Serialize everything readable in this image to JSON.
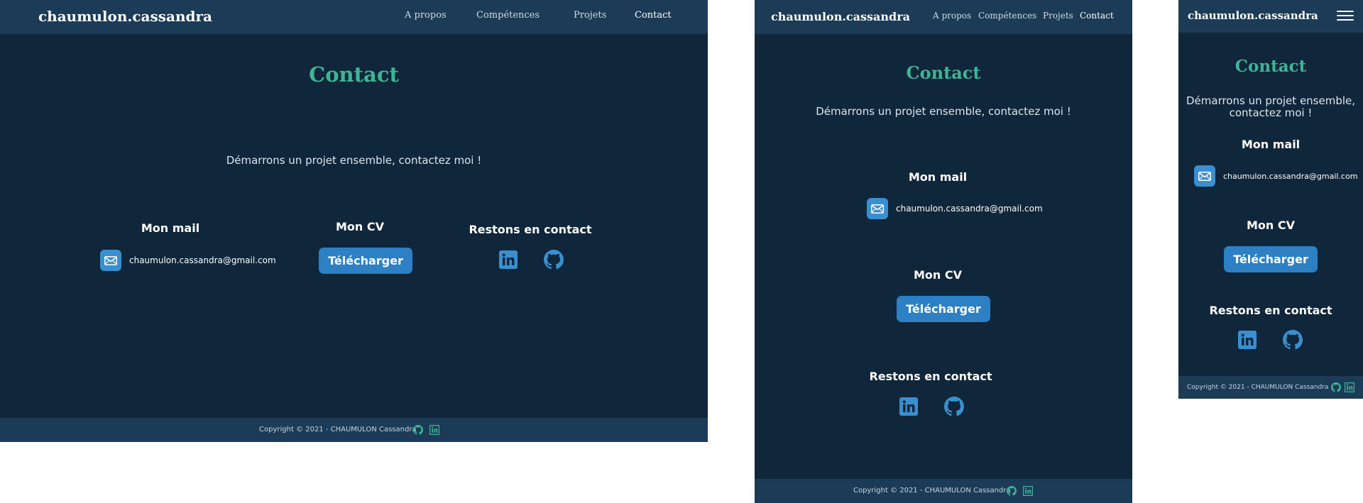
{
  "site": {
    "brand": "chaumulon.cassandra",
    "nav": [
      "A propos",
      "Compétences",
      "Projets",
      "Contact"
    ]
  },
  "contact": {
    "title": "Contact",
    "intro": "Démarrons un projet ensemble, contactez moi !",
    "mail_heading": "Mon mail",
    "email": "chaumulon.cassandra@gmail.com",
    "cv_heading": "Mon CV",
    "cv_button": "Télécharger",
    "social_heading": "Restons en contact"
  },
  "footer": {
    "copyright": "Copyright © 2021 - CHAUMULON Cassandra"
  },
  "icons": {
    "mail": "mail-icon",
    "linkedin": "linkedin-icon",
    "github": "github-icon",
    "menu": "hamburger-menu-icon"
  },
  "colors": {
    "page_bg": "#10263a",
    "header_bg": "#1b3b56",
    "accent_green": "#3fb596",
    "button_blue": "#2d80c4",
    "icon_blue": "#3a8fd1"
  }
}
